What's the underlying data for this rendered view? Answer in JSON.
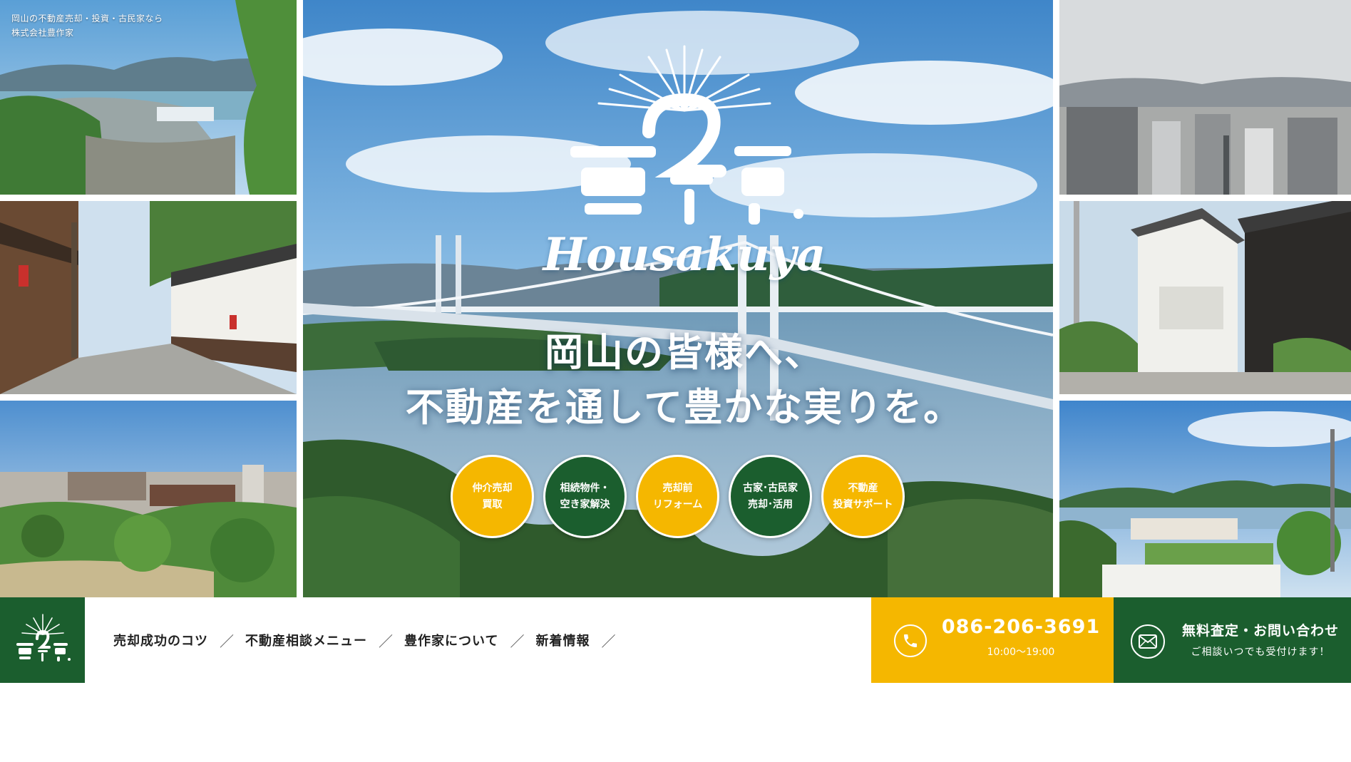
{
  "site": {
    "tagline_line1": "岡山の不動産売却・投資・古民家なら",
    "tagline_line2": "株式会社豊作家",
    "logo_text": "Housakuya"
  },
  "hero": {
    "headline_line1": "岡山の皆様へ、",
    "headline_line2": "不動産を通して豊かな実りを。",
    "photos": [
      {
        "name": "harbor-town-photo",
        "scene": "harbor town from hill"
      },
      {
        "name": "old-street-photo",
        "scene": "traditional street"
      },
      {
        "name": "garden-city-photo",
        "scene": "garden and city"
      },
      {
        "name": "bridge-photo",
        "scene": "Seto Ohashi bridge and islands"
      },
      {
        "name": "city-skyline-photo",
        "scene": "city skyline"
      },
      {
        "name": "storehouse-photo",
        "scene": "white storehouses"
      },
      {
        "name": "bay-village-photo",
        "scene": "bay village"
      }
    ]
  },
  "services": [
    {
      "label": "仲介売却\n買取",
      "color": "#f5b700"
    },
    {
      "label": "相続物件・\n空き家解決",
      "color": "#1b5e2e"
    },
    {
      "label": "売却前\nリフォーム",
      "color": "#f5b700"
    },
    {
      "label": "古家･古民家\n売却･活用",
      "color": "#1b5e2e"
    },
    {
      "label": "不動産\n投資サポート",
      "color": "#f5b700"
    }
  ],
  "nav": {
    "items": [
      "売却成功のコツ",
      "不動産相談メニュー",
      "豊作家について",
      "新着情報"
    ],
    "separator": "／"
  },
  "contact": {
    "phone": "086-206-3691",
    "hours": "10:00〜19:00",
    "mail_title": "無料査定・お問い合わせ",
    "mail_sub": "ご相談いつでも受付けます！"
  },
  "colors": {
    "green": "#1b5e2e",
    "yellow": "#f5b700",
    "sky": "#6aa8d8"
  },
  "icons": [
    "phone-icon",
    "mail-icon",
    "logo-icon"
  ]
}
